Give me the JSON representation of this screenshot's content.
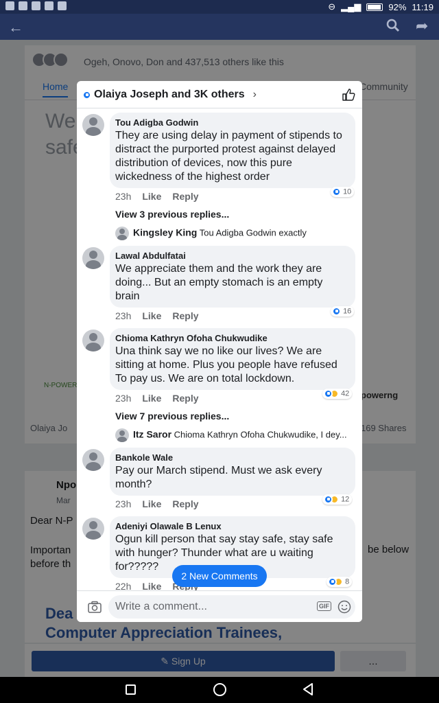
{
  "status_bar": {
    "battery": "92%",
    "time": "11:19"
  },
  "background": {
    "likes_text": "Ogeh, Onovo, Don and 437,513 others like this",
    "tab_home": "Home",
    "tab_community": "Community",
    "headline": "We\nsafe",
    "logo_left": "N-POWER",
    "logo_right": "powerng",
    "poster": "Olaiya Jo",
    "shares": "169 Shares",
    "post2_author": "Npo",
    "post2_date": "Mar",
    "post2_p1": "Dear N-P",
    "post2_p2": "Importan\nbefore th",
    "post2_p3": "be below",
    "post2_bigtitle": "Dea\nComputer Appreciation Trainees,",
    "signup": "Sign Up",
    "more": "…"
  },
  "modal": {
    "title": "Olaiya Joseph and 3K others",
    "comments": [
      {
        "name": "Tou Adigba Godwin",
        "text": "They are using delay in payment of stipends to distract the purported protest against delayed distribution of devices, now this pure wickedness of the highest order",
        "time": "23h",
        "like": "Like",
        "reply": "Reply",
        "reactions": "10"
      },
      {
        "name": "Lawal Abdulfatai",
        "text": "We appreciate them and the work they are doing... But an empty stomach is an empty brain",
        "time": "23h",
        "like": "Like",
        "reply": "Reply",
        "reactions": "16"
      },
      {
        "name": "Chioma Kathryn Ofoha Chukwudike",
        "text": "Una think say we no like our lives? We are sitting at home. Plus you people have refused To pay us. We are on total lockdown.",
        "time": "23h",
        "like": "Like",
        "reply": "Reply",
        "reactions": "42"
      },
      {
        "name": "Bankole Wale",
        "text": "Pay our March stipend.  Must we ask every month?",
        "time": "23h",
        "like": "Like",
        "reply": "Reply",
        "reactions": "12"
      },
      {
        "name": "Adeniyi Olawale B Lenux",
        "text": "Ogun kill person that say stay safe, stay safe with hunger? Thunder what are u waiting for?????",
        "time": "22h",
        "like": "Like",
        "reply": "Reply",
        "reactions": "8"
      }
    ],
    "view_replies_1": "View 3 previous replies...",
    "reply_1_name": "Kingsley King",
    "reply_1_text": "Tou Adigba Godwin exactly",
    "view_replies_2": "View 7 previous replies...",
    "reply_2_name": "Itz Saror",
    "reply_2_text": "Chioma Kathryn Ofoha Chukwudike, I dey...",
    "new_comments": "2 New Comments",
    "composer_placeholder": "Write a comment...",
    "gif": "GIF"
  }
}
